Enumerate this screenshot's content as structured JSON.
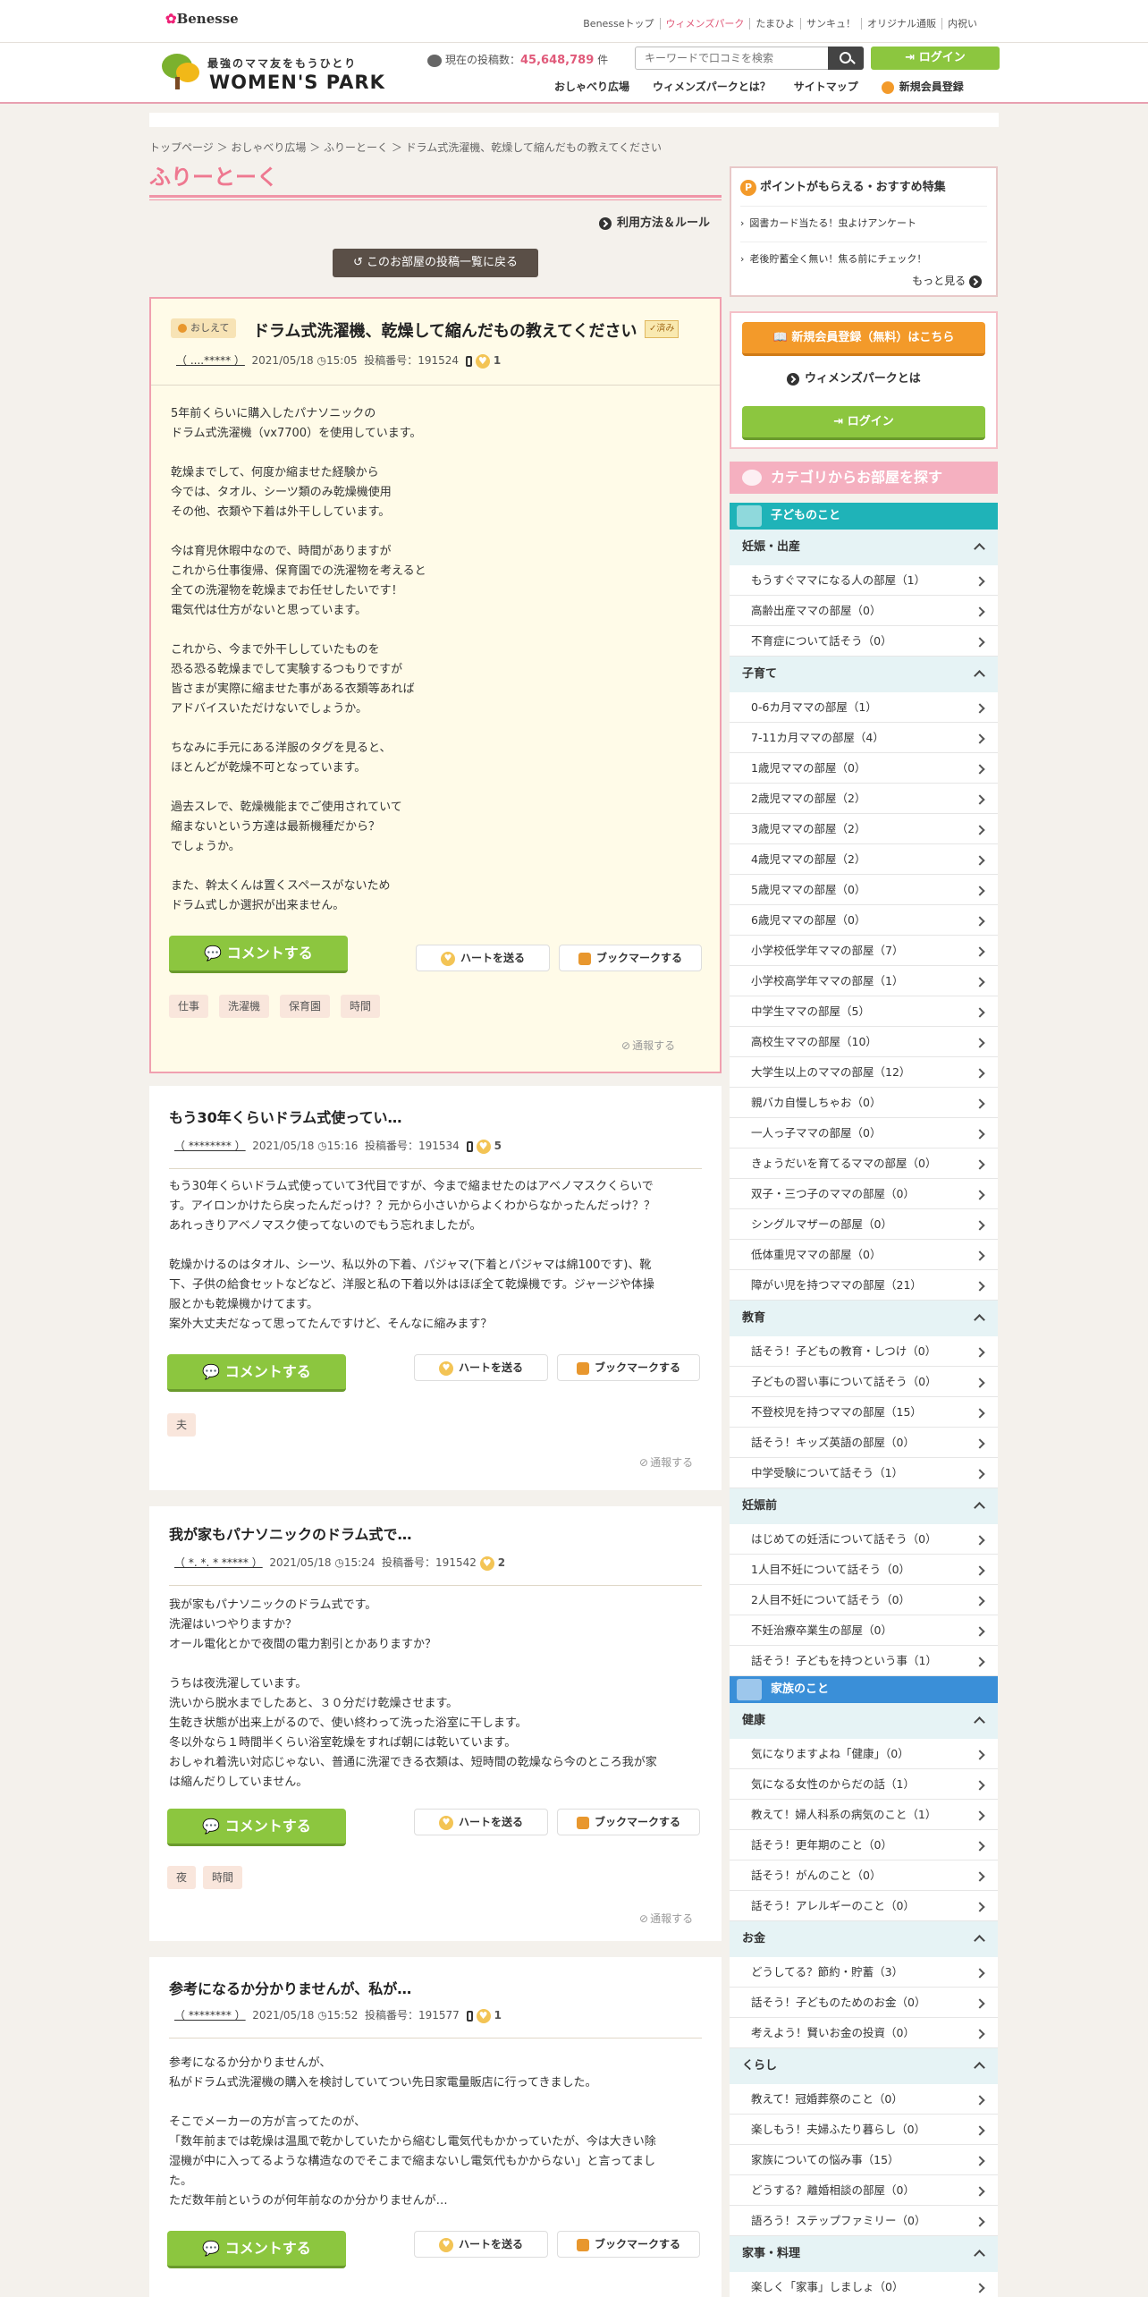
{
  "topbar": {
    "logo": "Benesse",
    "links": [
      "Benesseトップ",
      "ウィメンズパーク",
      "たまひよ",
      "サンキュ！",
      "オリジナル通販",
      "内祝い"
    ]
  },
  "header": {
    "logo_sub": "最強のママ友をもうひとり",
    "logo_main": "WOMEN'S PARK",
    "post_count_label": "現在の投稿数：",
    "post_count": "45,648,789",
    "post_count_unit": "件",
    "search_placeholder": "キーワードで口コミを検索",
    "login": "ログイン",
    "nav": [
      "おしゃべり広場",
      "ウィメンズパークとは？",
      "サイトマップ",
      "新規会員登録"
    ]
  },
  "breadcrumb": "トップページ ＞ おしゃべり広場 ＞ ふりーとーく ＞ ドラム式洗濯機、乾燥して縮んだもの教えてください",
  "room_title": "ふりーとーく",
  "rules": "利用方法＆ルール",
  "back_button": "このお部屋の投稿一覧に戻る",
  "main_post": {
    "badge": "おしえて",
    "title": "ドラム式洗濯機、乾燥して縮んだもの教えてください",
    "resolved": "✓済み",
    "user": "（ ....*****  ）",
    "date": "2021/05/18",
    "time": "15:05",
    "post_no": "投稿番号：191524",
    "hearts": "1",
    "body": "5年前くらいに購入したパナソニックの\nドラム式洗濯機（vx7700）を使用しています。\n\n乾燥までして、何度か縮ませた経験から\n今では、タオル、シーツ類のみ乾燥機使用\nその他、衣類や下着は外干ししています。\n\n今は育児休暇中なので、時間がありますが\nこれから仕事復帰、保育園での洗濯物を考えると\n全ての洗濯物を乾燥までお任せしたいです！\n電気代は仕方がないと思っています。\n\nこれから、今まで外干ししていたものを\n恐る恐る乾燥までして実験するつもりですが\n皆さまが実際に縮ませた事がある衣類等あれば\nアドバイスいただけないでしょうか。\n\nちなみに手元にある洋服のタグを見ると、\nほとんどが乾燥不可となっています。\n\n過去スレで、乾燥機能までご使用されていて\n縮まないという方達は最新機種だから？\nでしょうか。\n\nまた、幹太くんは置くスペースがないため\nドラム式しか選択が出来ません。",
    "tags": [
      "仕事",
      "洗濯機",
      "保育園",
      "時間"
    ]
  },
  "buttons": {
    "comment": "コメントする",
    "heart": "ハートを送る",
    "bookmark": "ブックマークする",
    "report": "通報する"
  },
  "replies": [
    {
      "title": "もう30年くらいドラム式使ってい…",
      "user": "（ ********  ）",
      "date": "2021/05/18",
      "time": "15:16",
      "post_no": "投稿番号：191534",
      "hearts": "5",
      "body": "もう30年くらいドラム式使っていて3代目ですが、今まで縮ませたのはアベノマスクくらいで\nす。アイロンかけたら戻ったんだっけ？？元から小さいからよくわからなかったんだっけ？？\nあれっきりアベノマスク使ってないのでもう忘れましたが。\n\n乾燥かけるのはタオル、シーツ、私以外の下着、パジャマ(下着とパジャマは綿100です)、靴\n下、子供の給食セットなどなど、洋服と私の下着以外はほぼ全て乾燥機です。ジャージや体操\n服とかも乾燥機かけてます。\n案外大丈夫だなって思ってたんですけど、そんなに縮みます？",
      "tags": [
        "夫"
      ]
    },
    {
      "title": "我が家もパナソニックのドラム式で…",
      "user": "（ *. *. * *****  ）",
      "date": "2021/05/18",
      "time": "15:24",
      "post_no": "投稿番号：191542",
      "hearts": "2",
      "body": "我が家もパナソニックのドラム式です。\n洗濯はいつやりますか？\nオール電化とかで夜間の電力割引とかありますか？\n\nうちは夜洗濯しています。\n洗いから脱水までしたあと、３０分だけ乾燥させます。\n生乾き状態が出来上がるので、使い終わって洗った浴室に干します。\n冬以外なら１時間半くらい浴室乾燥をすれば朝には乾いています。\nおしゃれ着洗い対応じゃない、普通に洗濯できる衣類は、短時間の乾燥なら今のところ我が家\nは縮んだりしていません。",
      "tags": [
        "夜",
        "時間"
      ]
    },
    {
      "title": "参考になるか分かりませんが、私が…",
      "user": "（ ********  ）",
      "date": "2021/05/18",
      "time": "15:52",
      "post_no": "投稿番号：191577",
      "hearts": "1",
      "body": "参考になるか分かりませんが、\n私がドラム式洗濯機の購入を検討していてつい先日家電量販店に行ってきました。\n\nそこでメーカーの方が言ってたのが、\n「数年前までは乾燥は温風で乾かしていたから縮むし電気代もかかっていたが、今は大きい除\n湿機が中に入ってるような構造なのでそこまで縮まないし電気代もかからない」と言ってまし\nた。\nただ数年前というのが何年前なのか分かりませんが…",
      "tags": []
    }
  ],
  "promo": {
    "title": "ポイントがもらえる・おすすめ特集",
    "items": [
      "図書カード当たる！虫よけアンケート",
      "老後貯蓄全く無い！焦る前にチェック！"
    ],
    "more": "もっと見る"
  },
  "member": {
    "register": "新規会員登録（無料）はこちら",
    "about": "ウィメンズパークとは",
    "login": "ログイン"
  },
  "category_title": "カテゴリからお部屋を探す",
  "sections": [
    {
      "name": "子どものこと",
      "color": "#1fb3b8",
      "groups": [
        {
          "name": "妊娠・出産",
          "rooms": [
            "もうすぐママになる人の部屋（1）",
            "高齢出産ママの部屋（0）",
            "不育症について話そう（0）"
          ]
        },
        {
          "name": "子育て",
          "rooms": [
            "0-6カ月ママの部屋（1）",
            "7-11カ月ママの部屋（4）",
            "1歳児ママの部屋（0）",
            "2歳児ママの部屋（2）",
            "3歳児ママの部屋（2）",
            "4歳児ママの部屋（2）",
            "5歳児ママの部屋（0）",
            "6歳児ママの部屋（0）",
            "小学校低学年ママの部屋（7）",
            "小学校高学年ママの部屋（1）",
            "中学生ママの部屋（5）",
            "高校生ママの部屋（10）",
            "大学生以上のママの部屋（12）",
            "親バカ自慢しちゃお（0）",
            "一人っ子ママの部屋（0）",
            "きょうだいを育てるママの部屋（0）",
            "双子・三つ子のママの部屋（0）",
            "シングルマザーの部屋（0）",
            "低体重児ママの部屋（0）",
            "障がい児を持つママの部屋（21）"
          ]
        },
        {
          "name": "教育",
          "rooms": [
            "話そう！子どもの教育・しつけ（0）",
            "子どもの習い事について話そう（0）",
            "不登校児を持つママの部屋（15）",
            "話そう！キッズ英語の部屋（0）",
            "中学受験について話そう（1）"
          ]
        },
        {
          "name": "妊娠前",
          "rooms": [
            "はじめての妊活について話そう（0）",
            "1人目不妊について話そう（0）",
            "2人目不妊について話そう（0）",
            "不妊治療卒業生の部屋（0）",
            "話そう！子どもを持つという事（1）"
          ]
        }
      ]
    },
    {
      "name": "家族のこと",
      "color": "#3a8fd8",
      "groups": [
        {
          "name": "健康",
          "rooms": [
            "気になりますよね「健康」（0）",
            "気になる女性のからだの話（1）",
            "教えて！婦人科系の病気のこと（1）",
            "話そう！更年期のこと（0）",
            "話そう！がんのこと（0）",
            "話そう！アレルギーのこと（0）"
          ]
        },
        {
          "name": "お金",
          "rooms": [
            "どうしてる？節約・貯蓄（3）",
            "話そう！子どものためのお金（0）",
            "考えよう！賢いお金の投資（0）"
          ]
        },
        {
          "name": "くらし",
          "rooms": [
            "教えて！冠婚葬祭のこと（0）",
            "楽しもう！夫婦ふたり暮らし（0）",
            "家族についての悩み事（15）",
            "どうする？離婚相談の部屋（0）",
            "語ろう！ステップファミリー（0）"
          ]
        },
        {
          "name": "家事・料理",
          "rooms": [
            "楽しく「家事」しましょ（0）"
          ]
        }
      ]
    }
  ]
}
